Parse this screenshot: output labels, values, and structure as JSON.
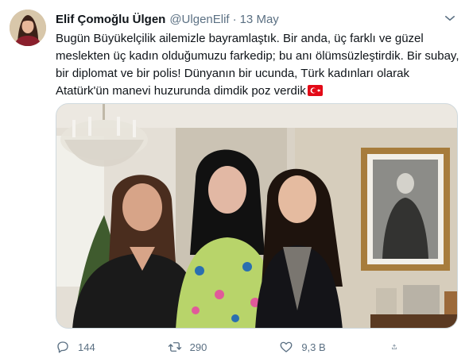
{
  "tweet": {
    "author_name": "Elif Çomoğlu Ülgen",
    "handle": "@UlgenElif",
    "separator": "·",
    "date": "13 May",
    "text_lines": [
      "Bugün Büyükelçilik ailemizle bayramlaştık. Bir anda, üç farklı ve güzel",
      "meslekten üç kadın olduğumuzu farkedip; bu anı ölümsüzleştirdik. Bir subay,",
      "bir diplomat ve bir polis! Dünyanın bir ucunda, Türk kadınları olarak",
      "Atatürk'ün manevi huzurunda dimdik poz verdik"
    ],
    "flag_emoji": "turkey-flag-icon"
  },
  "actions": {
    "reply_count": "144",
    "retweet_count": "290",
    "like_count": "9,3 B"
  },
  "icons": {
    "more": "more-icon",
    "reply": "reply-icon",
    "retweet": "retweet-icon",
    "like": "like-icon",
    "share": "share-icon"
  },
  "colors": {
    "text_primary": "#0f1419",
    "text_secondary": "#5b7083",
    "flag_red": "#e30a17"
  }
}
